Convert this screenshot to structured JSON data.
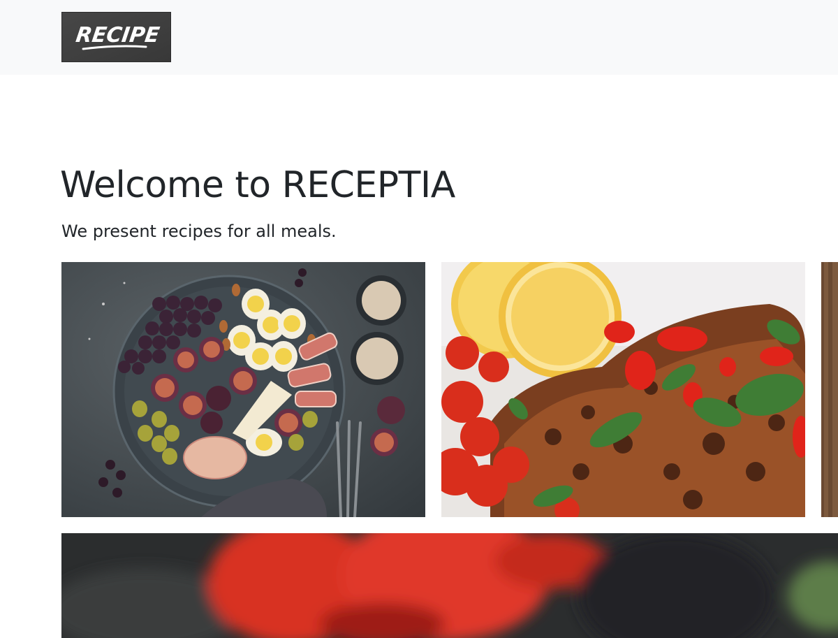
{
  "header": {
    "logo_text": "RECIPE"
  },
  "hero": {
    "title": "Welcome to RECEPTIA",
    "subtitle": "We present recipes for all meals."
  },
  "gallery": {
    "images": [
      {
        "subject": "platter with figs, grapes, eggs, cheese and prosciutto"
      },
      {
        "subject": "roasted chicken with tomatoes, chili and lemon"
      },
      {
        "subject": "partially visible food photo"
      }
    ],
    "banner": {
      "subject": "blurred close-up of red vegetables"
    }
  },
  "colors": {
    "navbar_bg": "#f8f9fa",
    "logo_bg": "#3f3f3f",
    "text": "#212529"
  }
}
